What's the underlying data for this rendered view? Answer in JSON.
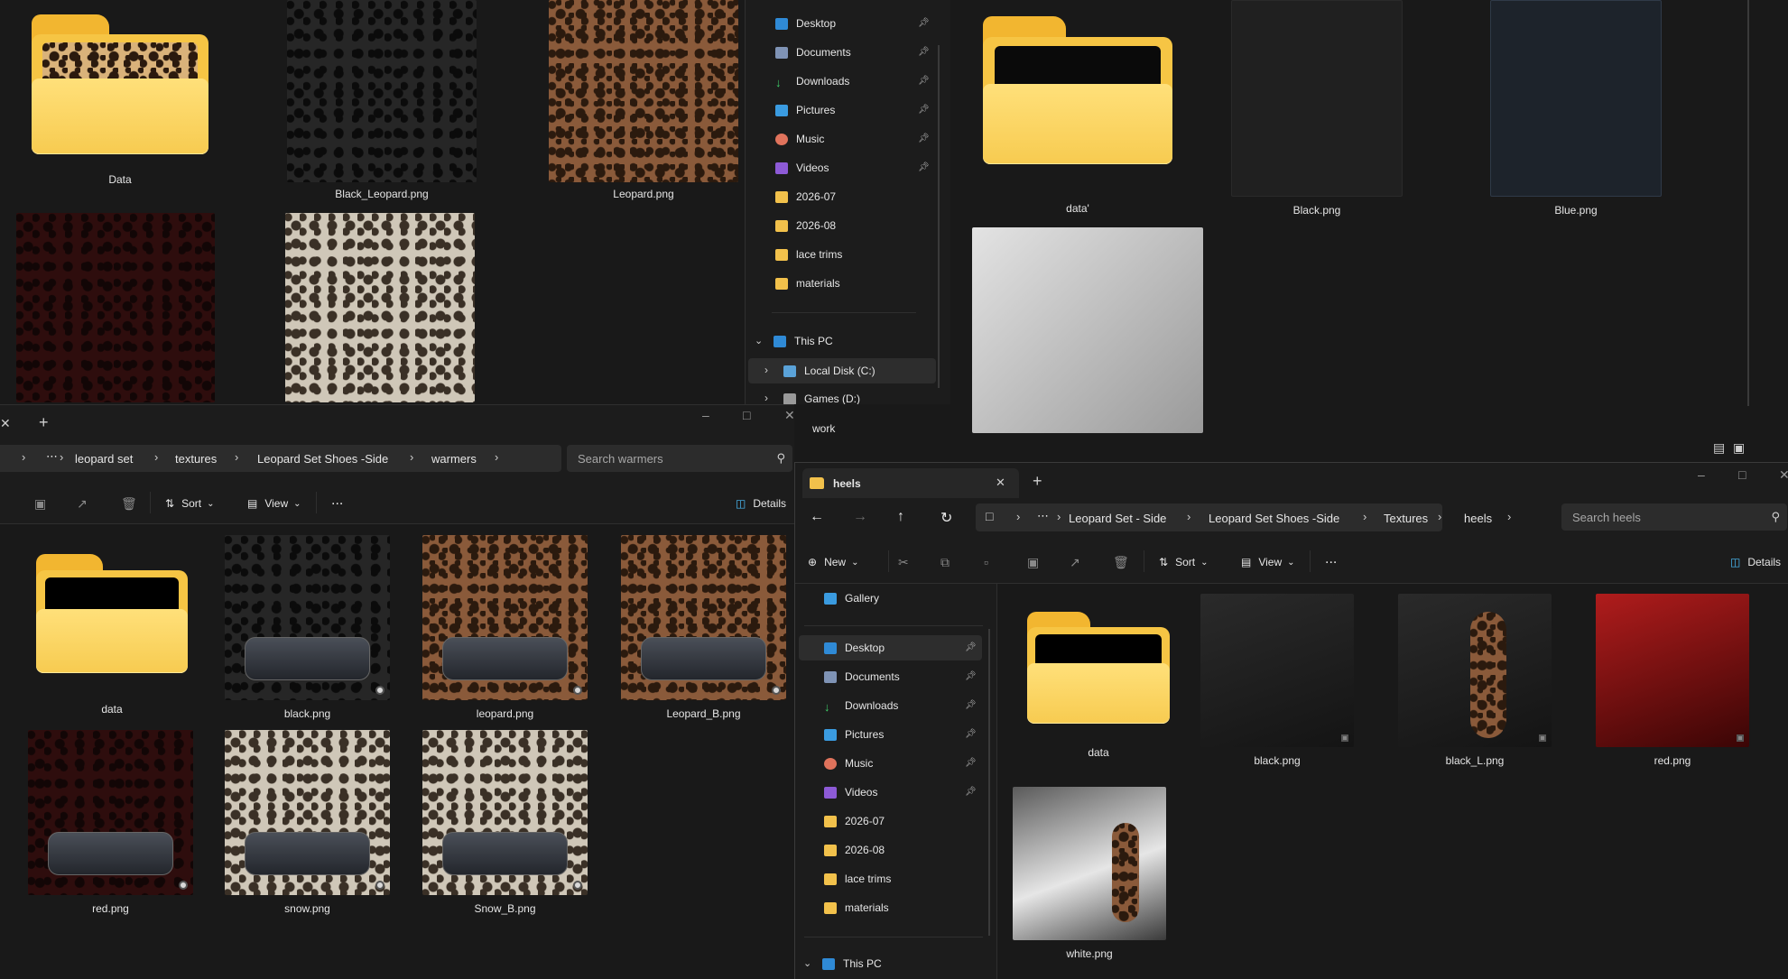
{
  "top_left_files": [
    {
      "name": "Data",
      "type": "folder"
    },
    {
      "name": "Black_Leopard.png",
      "type": "image"
    },
    {
      "name": "Leopard.png",
      "type": "image"
    },
    {
      "name": "",
      "type": "image"
    },
    {
      "name": "",
      "type": "image"
    }
  ],
  "top_nav": {
    "items": [
      {
        "label": "Desktop",
        "icon": "desktop-icon",
        "pinned": true
      },
      {
        "label": "Documents",
        "icon": "documents-icon",
        "pinned": true
      },
      {
        "label": "Downloads",
        "icon": "downloads-icon",
        "pinned": true
      },
      {
        "label": "Pictures",
        "icon": "pictures-icon",
        "pinned": true
      },
      {
        "label": "Music",
        "icon": "music-icon",
        "pinned": true
      },
      {
        "label": "Videos",
        "icon": "videos-icon",
        "pinned": true
      },
      {
        "label": "2026-07",
        "icon": "folder-icon"
      },
      {
        "label": "2026-08",
        "icon": "folder-icon"
      },
      {
        "label": "lace trims",
        "icon": "folder-icon"
      },
      {
        "label": "materials",
        "icon": "folder-icon"
      }
    ],
    "this_pc": "This PC",
    "local_disk": "Local Disk (C:)",
    "games": "Games (D:)",
    "work": "work"
  },
  "top_right_files": [
    {
      "name": "data'",
      "type": "folder"
    },
    {
      "name": "Black.png",
      "type": "image"
    },
    {
      "name": "Blue.png",
      "type": "image"
    },
    {
      "name": "",
      "type": "image"
    }
  ],
  "warmers_window": {
    "breadcrumb": [
      "leopard set",
      "textures",
      "Leopard Set Shoes -Side",
      "warmers"
    ],
    "search_placeholder": "Search warmers",
    "toolbar": {
      "sort": "Sort",
      "view": "View",
      "more": "...",
      "details": "Details"
    },
    "files": [
      {
        "name": "data",
        "type": "folder"
      },
      {
        "name": "black.png",
        "type": "image"
      },
      {
        "name": "leopard.png",
        "type": "image"
      },
      {
        "name": "Leopard_B.png",
        "type": "image"
      },
      {
        "name": "red.png",
        "type": "image"
      },
      {
        "name": "snow.png",
        "type": "image"
      },
      {
        "name": "Snow_B.png",
        "type": "image"
      }
    ]
  },
  "heels_window": {
    "tab_title": "heels",
    "breadcrumb": [
      "Leopard Set - Side",
      "Leopard Set Shoes -Side",
      "Textures",
      "heels"
    ],
    "search_placeholder": "Search heels",
    "toolbar": {
      "new": "New",
      "sort": "Sort",
      "view": "View",
      "more": "...",
      "details": "Details"
    },
    "nav": {
      "gallery": "Gallery",
      "items": [
        {
          "label": "Desktop",
          "pinned": true
        },
        {
          "label": "Documents",
          "pinned": true
        },
        {
          "label": "Downloads",
          "pinned": true
        },
        {
          "label": "Pictures",
          "pinned": true
        },
        {
          "label": "Music",
          "pinned": true
        },
        {
          "label": "Videos",
          "pinned": true
        },
        {
          "label": "2026-07"
        },
        {
          "label": "2026-08"
        },
        {
          "label": "lace trims"
        },
        {
          "label": "materials"
        }
      ],
      "this_pc": "This PC"
    },
    "files": [
      {
        "name": "data",
        "type": "folder"
      },
      {
        "name": "black.png",
        "type": "image"
      },
      {
        "name": "black_L.png",
        "type": "image"
      },
      {
        "name": "red.png",
        "type": "image"
      },
      {
        "name": "white.png",
        "type": "image"
      }
    ]
  },
  "colors": {
    "bg": "#191919",
    "accent": "#4cc2ff",
    "folder": "#f6c544"
  }
}
